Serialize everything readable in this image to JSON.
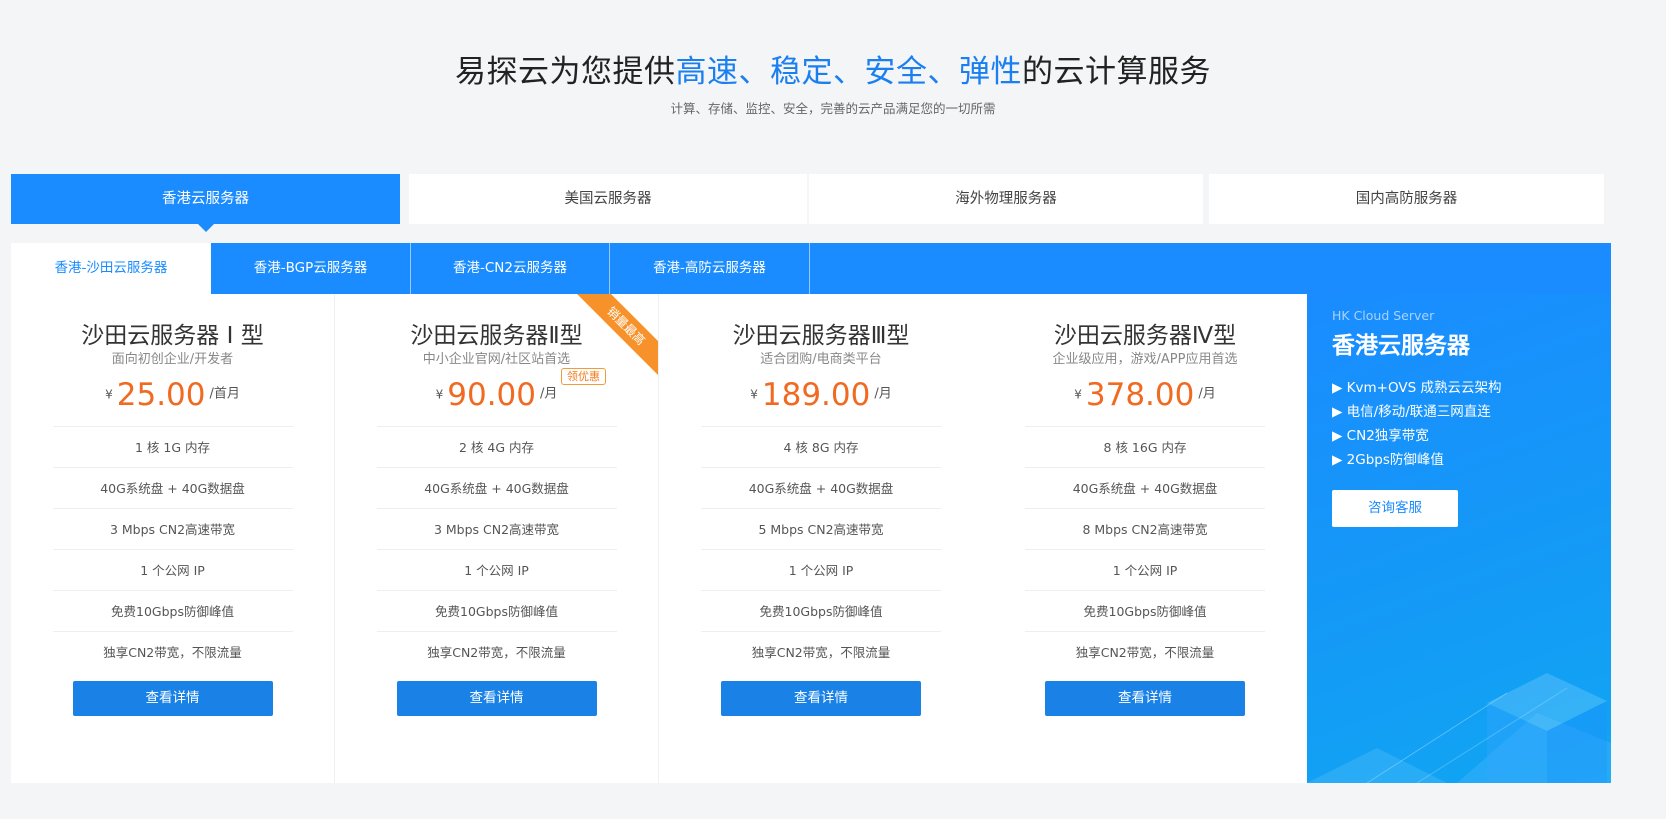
{
  "hero": {
    "title_pre": "易探云为您提供",
    "title_highlight": "高速、稳定、安全、弹性",
    "title_post": "的云计算服务",
    "subtitle": "计算、存储、监控、安全，完善的云产品满足您的一切所需"
  },
  "main_tabs": [
    {
      "label": "香港云服务器",
      "active": true
    },
    {
      "label": "美国云服务器",
      "active": false
    },
    {
      "label": "海外物理服务器",
      "active": false
    },
    {
      "label": "国内高防服务器",
      "active": false
    }
  ],
  "sub_tabs": [
    {
      "label": "香港-沙田云服务器",
      "active": true
    },
    {
      "label": "香港-BGP云服务器",
      "active": false
    },
    {
      "label": "香港-CN2云服务器",
      "active": false
    },
    {
      "label": "香港-高防云服务器",
      "active": false
    }
  ],
  "cards": [
    {
      "title": "沙田云服务器 I 型",
      "desc": "面向初创企业/开发者",
      "currency": "¥",
      "price": "25.00",
      "unit": "/首月",
      "specs": [
        "1 核 1G 内存",
        "40G系统盘 + 40G数据盘",
        "3 Mbps CN2高速带宽",
        "1 个公网 IP",
        "免费10Gbps防御峰值",
        "独享CN2带宽，不限流量"
      ],
      "button": "查看详情"
    },
    {
      "title": "沙田云服务器Ⅱ型",
      "desc": "中小企业官网/社区站首选",
      "currency": "¥",
      "price": "90.00",
      "unit": "/月",
      "ribbon": "销量最高",
      "badge": "领优惠",
      "specs": [
        "2 核 4G 内存",
        "40G系统盘 + 40G数据盘",
        "3 Mbps CN2高速带宽",
        "1 个公网 IP",
        "免费10Gbps防御峰值",
        "独享CN2带宽，不限流量"
      ],
      "button": "查看详情"
    },
    {
      "title": "沙田云服务器Ⅲ型",
      "desc": "适合团购/电商类平台",
      "currency": "¥",
      "price": "189.00",
      "unit": "/月",
      "specs": [
        "4 核 8G 内存",
        "40G系统盘 + 40G数据盘",
        "5 Mbps CN2高速带宽",
        "1 个公网 IP",
        "免费10Gbps防御峰值",
        "独享CN2带宽，不限流量"
      ],
      "button": "查看详情"
    },
    {
      "title": "沙田云服务器Ⅳ型",
      "desc": "企业级应用，游戏/APP应用首选",
      "currency": "¥",
      "price": "378.00",
      "unit": "/月",
      "specs": [
        "8 核 16G 内存",
        "40G系统盘 + 40G数据盘",
        "8 Mbps CN2高速带宽",
        "1 个公网 IP",
        "免费10Gbps防御峰值",
        "独享CN2带宽，不限流量"
      ],
      "button": "查看详情"
    }
  ],
  "promo": {
    "en_title": "HK Cloud Server",
    "title": "香港云服务器",
    "features": [
      "▶ Kvm+OVS 成熟云云架构",
      "▶ 电信/移动/联通三网直连",
      "▶ CN2独享带宽",
      "▶ 2Gbps防御峰值"
    ],
    "button": "咨询客服"
  },
  "colors": {
    "accent": "#1a8cff",
    "price": "#f06a22",
    "ribbon": "#f7922a",
    "button": "#1a82e6"
  }
}
